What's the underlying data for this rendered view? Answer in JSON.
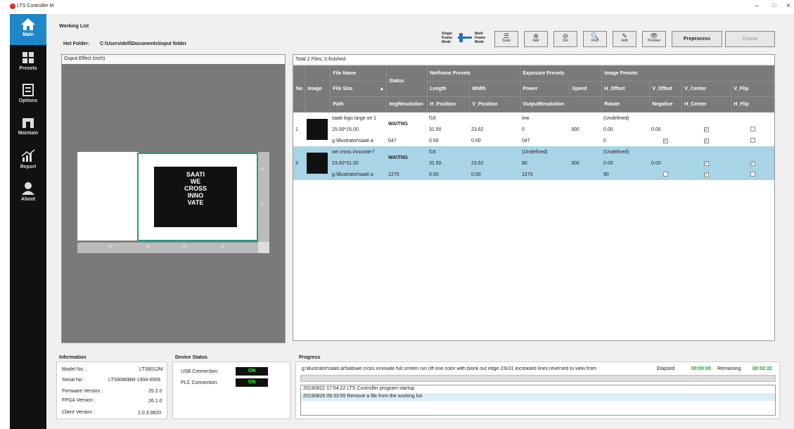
{
  "app": {
    "title": "LTS Controller M",
    "min": "–",
    "max": "□",
    "close": "×"
  },
  "nav": [
    {
      "label": "Main"
    },
    {
      "label": "Presets"
    },
    {
      "label": "Options"
    },
    {
      "label": "Maintain"
    },
    {
      "label": "Report"
    },
    {
      "label": "About"
    }
  ],
  "working_list": {
    "title": "Working List",
    "hot_folder_label": "Hot Folder:",
    "hot_folder_path": "C:\\Users\\dell\\Documents\\input folder",
    "mode_single": "Single\nFrame\nMode",
    "mode_multi": "Multi\nFrame\nMode"
  },
  "toolbar": [
    {
      "label": "Scan",
      "glyph": "☰"
    },
    {
      "label": "Add",
      "glyph": "⊕"
    },
    {
      "label": "Del",
      "glyph": "⊖"
    },
    {
      "label": "Find",
      "glyph": "🔍"
    },
    {
      "label": "Edit",
      "glyph": "✎"
    },
    {
      "label": "Preview",
      "glyph": "👁"
    }
  ],
  "preprocess": "Preprocess",
  "output": "Output",
  "preview": {
    "title": "Ouput Effect  (inch)",
    "ruler_x": [
      "40",
      "30",
      "20",
      "10"
    ],
    "ruler_y": [
      "20",
      "10"
    ],
    "art_text": "SAATI\nWE\nCROSS\nINNO\nVATE"
  },
  "grid": {
    "summary": "Total 2 Files, 0 finished.",
    "headers": {
      "r1": [
        "No",
        "Image",
        "File Name",
        "Status",
        "Netframe Presets",
        "Exposure Presets",
        "Image Presets"
      ],
      "r2": [
        "File Size",
        "Length",
        "Width",
        "Power",
        "Speed",
        "H_Offset",
        "V_Offset",
        "V_Center",
        "V_Flip"
      ],
      "r3": [
        "Path",
        "ImgResolution",
        "H_Position",
        "V_Position",
        "OutputResolution",
        "Rotate",
        "Negative",
        "H_Center",
        "H_Flip"
      ]
    },
    "rows": [
      {
        "no": "1",
        "name": "saati logo large on 1",
        "status": "WAITNG",
        "frame": "f16",
        "exposure": "low",
        "image": "(Undefined)",
        "size": "15.00*15.00",
        "length": "31.50",
        "width": "23.62",
        "power": "0",
        "speed": "300",
        "h_offset": "0.00",
        "v_offset": "0.00",
        "path": "g:\\illustrator\\saati a",
        "imgres": "047",
        "h_pos": "0.00",
        "v_pos": "0.00",
        "outres": "047",
        "rotate": "0",
        "v_center": true,
        "v_flip": false,
        "negative": true,
        "h_center": true,
        "h_flip": false
      },
      {
        "no": "3",
        "name": "we cross innovate f",
        "status": "WAITNG",
        "frame": "f16",
        "exposure": "(Undefined)",
        "image": "(Undefined)",
        "size": "23.00*31.00",
        "length": "31.50",
        "width": "23.62",
        "power": "80",
        "speed": "300",
        "h_offset": "0.00",
        "v_offset": "0.00",
        "path": "g:\\illustrator\\saati a",
        "imgres": "1270",
        "h_pos": "0.00",
        "v_pos": "0.00",
        "outres": "1270",
        "rotate": "90",
        "v_center": true,
        "v_flip": true,
        "negative": false,
        "h_center": true,
        "h_flip": false
      }
    ]
  },
  "information": {
    "title": "Information",
    "model_label": "Model No :",
    "model": "LTS6012M",
    "serial_label": "Serial No :",
    "serial": "LTS6080BM-1904-0009",
    "fw_label": "Firmware Version :",
    "fw": "25.2.0",
    "fpga_label": "FPGA Version :",
    "fpga": "26.1.0",
    "client_label": "Client Version :",
    "client": "2.0.3.0820"
  },
  "device": {
    "title": "Device Status",
    "usb_label": "USB Connection:",
    "usb": "ON",
    "plc_label": "PLC Connection:",
    "plc": "ON"
  },
  "progress": {
    "title": "Progress",
    "file": "g:\\illustrator\\saati art\\lab\\we cross innovate full screen run off one color with block out edge 23x31 increased lines reversed to view from",
    "elapsed_label": "Elapsed",
    "elapsed": "00:00:00",
    "remaining_label": "Remaining",
    "remaining": "00:02:22",
    "log": [
      "20190822 17:54:22 LTS Controller program startup",
      "20190826 09:33:55 Remove a file from the working list"
    ]
  }
}
